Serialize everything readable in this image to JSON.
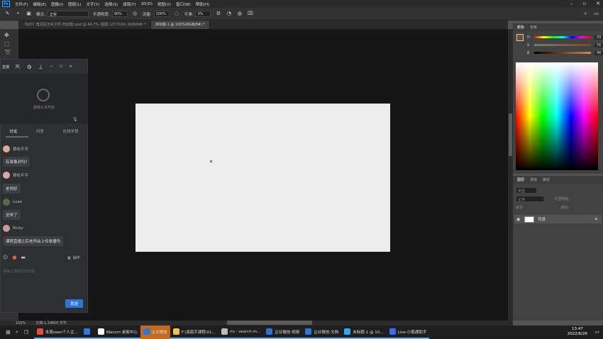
{
  "menubar": {
    "logo": "Ps",
    "items": [
      "文件(F)",
      "编辑(E)",
      "图像(I)",
      "图层(L)",
      "文字(Y)",
      "选择(S)",
      "滤镜(T)",
      "3D(D)",
      "视图(V)",
      "窗口(W)",
      "帮助(H)"
    ]
  },
  "options": {
    "mode_label": "模式:",
    "mode_value": "正常",
    "opacity_label": "不透明度:",
    "opacity_value": "90%",
    "flow_label": "流量:",
    "flow_value": "100%",
    "smoothing_label": "平滑:",
    "smoothing_value": "3%"
  },
  "tabs": [
    {
      "label": "《8/D》角羽羽王4(文件-无标题).psd @ 44.7% (图层 1/7/7104, RGB/8#) *",
      "active": false
    },
    {
      "label": "未标题-1 @ 100%(RGB/8#) *",
      "active": true
    }
  ],
  "color_panel": {
    "tabs": [
      "颜色",
      "色板"
    ],
    "sliders": [
      {
        "label": "H",
        "value": "29"
      },
      {
        "label": "S",
        "value": "76"
      },
      {
        "label": "B",
        "value": "48"
      }
    ]
  },
  "layers_panel": {
    "tabs": [
      "图层",
      "通道",
      "路径"
    ],
    "search_placeholder": "类型",
    "blend_mode": "正常",
    "opacity_label": "不透明度:",
    "lock_label": "锁定:",
    "fill_label": "填充:",
    "layer_name": "背景"
  },
  "status": {
    "zoom": "100%",
    "doc_info": "文档:1.19M/0 字节"
  },
  "wecom": {
    "top_left_text": "直播",
    "camera_text": "摄像头未开启",
    "tabs": [
      "讨论",
      "问答",
      "在线学员"
    ],
    "messages": [
      {
        "user": "章屹平平",
        "text": "有录像对吗?"
      },
      {
        "user": "章屹平平",
        "text": "老师好"
      },
      {
        "user": "Luke",
        "text": "进来了"
      },
      {
        "user": "Ricky",
        "text": "课程直播之后老师会上传录播吗"
      }
    ],
    "op_label": "操作",
    "input_placeholder": "请输入您的讨论内容",
    "send_label": "发送"
  },
  "taskbar": {
    "apps": [
      {
        "label": "本周sean个人主...",
        "color": "#e84c3d",
        "state": "open"
      },
      {
        "label": "",
        "color": "#2c7be5",
        "state": "open"
      },
      {
        "label": "Wacom 桌面中心",
        "color": "#ffffff",
        "state": "open"
      },
      {
        "label": "企业微信",
        "color": "#2d76d6",
        "state": "active"
      },
      {
        "label": "F:\\海南手课程\\01...",
        "color": "#f2c14e",
        "state": "open"
      },
      {
        "label": "rio - search-m...",
        "color": "#bbbbbb",
        "state": "open"
      },
      {
        "label": "企业微信-视频",
        "color": "#2d76d6",
        "state": "open"
      },
      {
        "label": "企业微信-文档",
        "color": "#2d76d6",
        "state": "open"
      },
      {
        "label": "未标题-1 @ 10...",
        "color": "#31a8ff",
        "state": "open"
      },
      {
        "label": "Live-小鹅通助手",
        "color": "#3b6cf5",
        "state": "open"
      }
    ],
    "time": "13:47",
    "date": "2022/6/26"
  }
}
